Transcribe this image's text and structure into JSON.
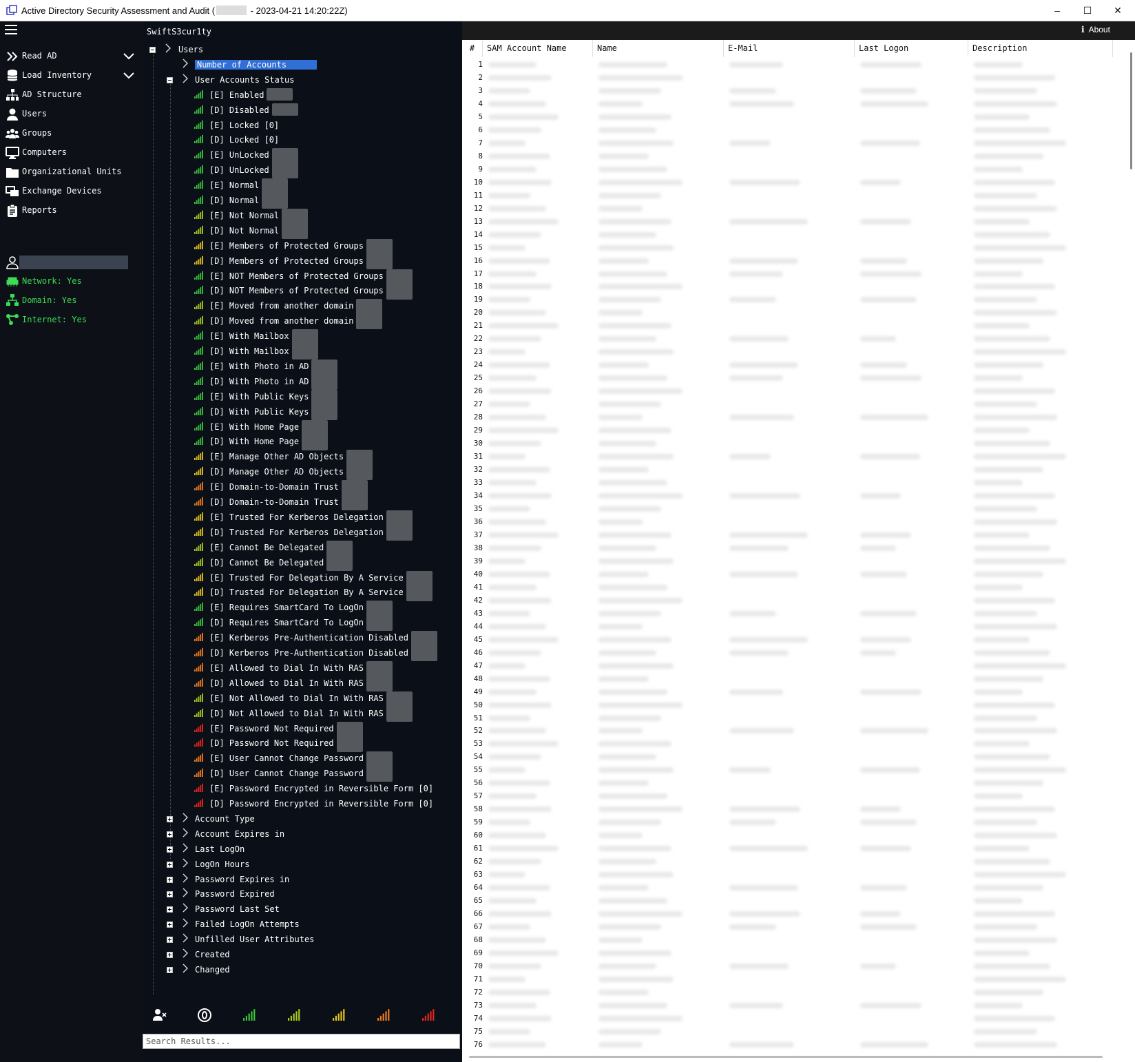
{
  "window": {
    "title_prefix": "Active Directory Security Assessment and Audit (",
    "title_suffix": " - 2023-04-21 14:20:22Z)",
    "controls": [
      "–",
      "☐",
      "✕"
    ]
  },
  "sidebar": {
    "nav": [
      {
        "label": "Read AD",
        "icon": "double-chevron-icon",
        "expandable": true
      },
      {
        "label": "Load Inventory",
        "icon": "database-icon",
        "expandable": true
      },
      {
        "label": "AD Structure",
        "icon": "hierarchy-icon"
      },
      {
        "label": "Users",
        "icon": "user-icon"
      },
      {
        "label": "Groups",
        "icon": "group-icon"
      },
      {
        "label": "Computers",
        "icon": "monitor-icon"
      },
      {
        "label": "Organizational Units",
        "icon": "folder-icon"
      },
      {
        "label": "Exchange Devices",
        "icon": "exchange-icon"
      },
      {
        "label": "Reports",
        "icon": "clipboard-icon"
      }
    ],
    "status": [
      {
        "label": "Network: Yes",
        "icon": "network-icon"
      },
      {
        "label": "Domain: Yes",
        "icon": "domain-icon"
      },
      {
        "label": "Internet: Yes",
        "icon": "internet-icon"
      }
    ],
    "status_color": "#3ddc54"
  },
  "tree": {
    "header": "SwiftS3cur1ty",
    "root": "Users",
    "selected": "Number of Accounts",
    "group": "User Accounts Status",
    "items": [
      {
        "label": "[E] Enabled",
        "level": 5
      },
      {
        "label": "[D] Disabled",
        "level": 5
      },
      {
        "label": "[E] Locked [0]",
        "level": 5
      },
      {
        "label": "[D] Locked [0]",
        "level": 5
      },
      {
        "label": "[E] UnLocked",
        "level": 5
      },
      {
        "label": "[D] UnLocked",
        "level": 5
      },
      {
        "label": "[E] Normal",
        "level": 5
      },
      {
        "label": "[D] Normal",
        "level": 5
      },
      {
        "label": "[E] Not Normal",
        "level": 4
      },
      {
        "label": "[D] Not Normal",
        "level": 4
      },
      {
        "label": "[E] Members of Protected Groups",
        "level": 3
      },
      {
        "label": "[D] Members of Protected Groups",
        "level": 3
      },
      {
        "label": "[E] NOT Members of Protected Groups",
        "level": 5
      },
      {
        "label": "[D] NOT Members of Protected Groups",
        "level": 5
      },
      {
        "label": "[E] Moved from another domain",
        "level": 4
      },
      {
        "label": "[D] Moved from another domain",
        "level": 4
      },
      {
        "label": "[E] With Mailbox",
        "level": 5
      },
      {
        "label": "[D] With Mailbox",
        "level": 5
      },
      {
        "label": "[E] With Photo in AD",
        "level": 5
      },
      {
        "label": "[D] With Photo in AD",
        "level": 5
      },
      {
        "label": "[E] With Public Keys",
        "level": 5
      },
      {
        "label": "[D] With Public Keys",
        "level": 5
      },
      {
        "label": "[E] With Home Page",
        "level": 5
      },
      {
        "label": "[D] With Home Page",
        "level": 5
      },
      {
        "label": "[E] Manage Other AD Objects",
        "level": 3
      },
      {
        "label": "[D] Manage Other AD Objects",
        "level": 3
      },
      {
        "label": "[E] Domain-to-Domain Trust",
        "level": 2
      },
      {
        "label": "[D] Domain-to-Domain Trust",
        "level": 2
      },
      {
        "label": "[E] Trusted For Kerberos Delegation",
        "level": 3
      },
      {
        "label": "[D] Trusted For Kerberos Delegation",
        "level": 3
      },
      {
        "label": "[E] Cannot Be Delegated",
        "level": 4
      },
      {
        "label": "[D] Cannot Be Delegated",
        "level": 4
      },
      {
        "label": "[E] Trusted For Delegation By A Service",
        "level": 3
      },
      {
        "label": "[D] Trusted For Delegation By A Service",
        "level": 3
      },
      {
        "label": "[E] Requires SmartCard To LogOn",
        "level": 5
      },
      {
        "label": "[D] Requires SmartCard To LogOn",
        "level": 5
      },
      {
        "label": "[E] Kerberos Pre-Authentication Disabled",
        "level": 2
      },
      {
        "label": "[D] Kerberos Pre-Authentication Disabled",
        "level": 2
      },
      {
        "label": "[E] Allowed to Dial In With RAS",
        "level": 2
      },
      {
        "label": "[D] Allowed to Dial In With RAS",
        "level": 2
      },
      {
        "label": "[E] Not Allowed to Dial In With RAS",
        "level": 4
      },
      {
        "label": "[D] Not Allowed to Dial In With RAS",
        "level": 4
      },
      {
        "label": "[E] Password Not Required",
        "level": 1
      },
      {
        "label": "[D] Password Not Required",
        "level": 1
      },
      {
        "label": "[E] User Cannot Change Password",
        "level": 2
      },
      {
        "label": "[D] User Cannot Change Password",
        "level": 2
      },
      {
        "label": "[E] Password Encrypted in Reversible Form [0]",
        "level": 1
      },
      {
        "label": "[D] Password Encrypted in Reversible Form [0]",
        "level": 1
      }
    ],
    "collapsed": [
      "Account Type",
      "Account Expires in",
      "Last LogOn",
      "LogOn Hours",
      "Password Expires in",
      "Password Expired",
      "Password Last Set",
      "Failed LogOn Attempts",
      "Unfilled User Attributes",
      "Created",
      "Changed"
    ],
    "level_colors": {
      "1": "#e8241e",
      "2": "#f07a1e",
      "3": "#e6c21c",
      "4": "#a8cc1e",
      "5": "#39c43a"
    }
  },
  "bottom_icons": [
    "remove-user-icon",
    "zero-circle-icon",
    "signal-green-icon",
    "signal-lime-icon",
    "signal-yellow-icon",
    "signal-orange-icon",
    "signal-red-icon"
  ],
  "search": {
    "placeholder": "Search Results..."
  },
  "grid": {
    "columns": [
      "#",
      "SAM Account Name",
      "Name",
      "E-Mail",
      "Last Logon",
      "Description"
    ],
    "row_count": 76
  },
  "about": "About"
}
